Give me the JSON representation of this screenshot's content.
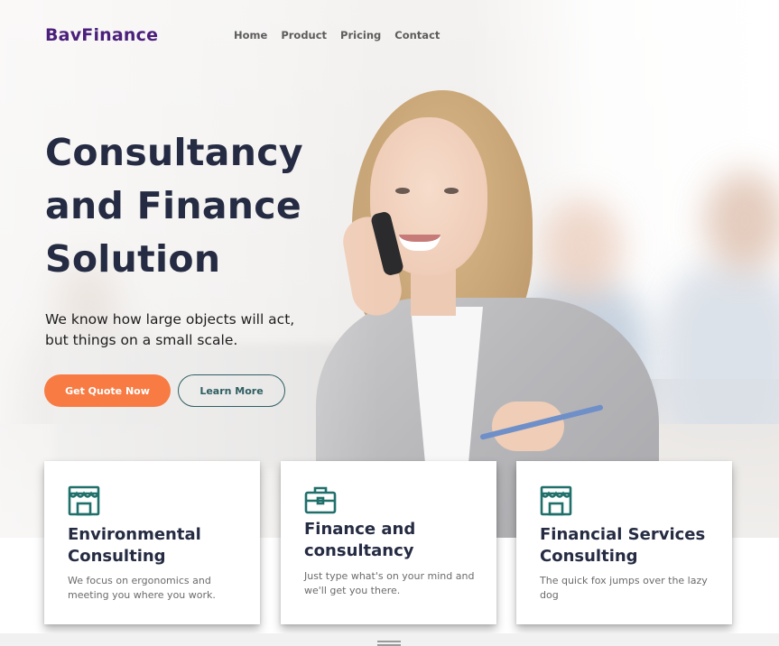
{
  "brand": {
    "name": "BavFinance"
  },
  "nav": {
    "items": [
      "Home",
      "Product",
      "Pricing",
      "Contact"
    ]
  },
  "hero": {
    "title": "Consultancy and Finance Solution",
    "subtitle": "We know how large objects will act, but things on a small scale.",
    "primary_cta": "Get Quote Now",
    "secondary_cta": "Learn More"
  },
  "cards": [
    {
      "icon": "storefront-icon",
      "title": "Environmental Consulting",
      "text": "We focus on ergonomics and meeting you where you work."
    },
    {
      "icon": "briefcase-icon",
      "title": "Finance and consultancy",
      "text": "Just type what's on your mind and we'll get you there."
    },
    {
      "icon": "storefront-icon",
      "title": "Financial Services Consulting",
      "text": "The quick fox jumps over the lazy dog"
    }
  ],
  "colors": {
    "brand": "#4b1f7c",
    "heading": "#252b42",
    "primary_button": "#f87b43",
    "secondary_button": "#2f5e61",
    "icon_teal": "#1f6f6b"
  }
}
